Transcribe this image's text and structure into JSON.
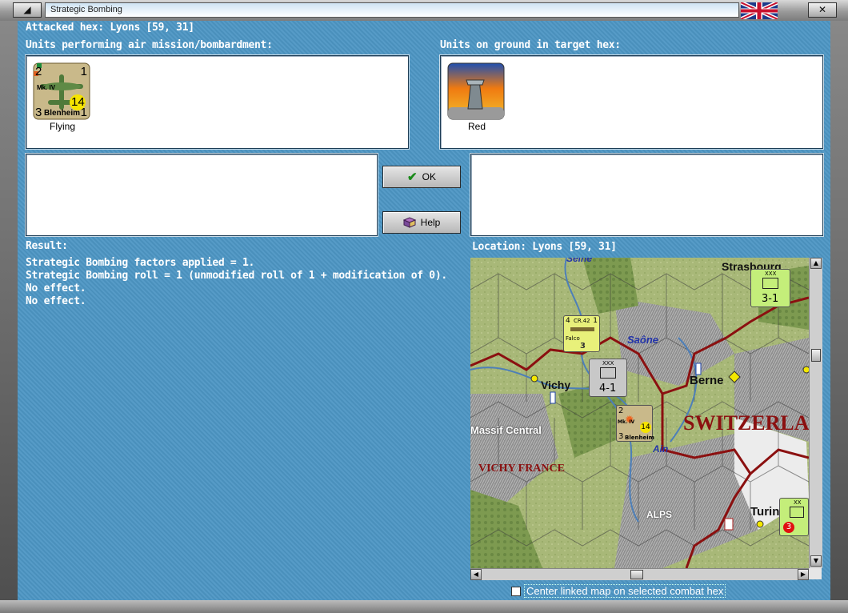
{
  "window": {
    "title": "Strategic Bombing",
    "close_glyph": "✕",
    "restore_glyph": "◢",
    "min_glyph": "⇤"
  },
  "header": {
    "attacked_hex": "Attacked hex: Lyons  [59, 31]"
  },
  "air_units": {
    "label": "Units performing air mission/bombardment:",
    "items": [
      {
        "counter_top_left": "2",
        "counter_top_right": "1",
        "counter_model": "Mk. IV",
        "counter_strength": "14",
        "counter_bottom_left": "3",
        "counter_bottom_right": "1",
        "counter_name": "Blenheim",
        "caption": "Flying"
      }
    ]
  },
  "ground_units": {
    "label": "Units on ground in target hex:",
    "items": [
      {
        "caption": "Red"
      }
    ]
  },
  "buttons": {
    "ok_label": "OK",
    "help_label": "Help"
  },
  "result": {
    "label": "Result:",
    "lines": [
      "Strategic Bombing factors applied = 1.",
      "Strategic Bombing roll = 1 (unmodified roll of 1 + modification of 0).",
      "No effect.",
      "No effect."
    ]
  },
  "location": {
    "label": "Location:  Lyons  [59, 31]"
  },
  "map": {
    "labels": {
      "seine": "Seine",
      "strasbourg": "Strasbourg",
      "saone": "Saône",
      "vichy": "Vichy",
      "berne": "Berne",
      "massif": "Massif Central",
      "switzerland": "SWITZERLAND",
      "vichy_france": "VICHY FRANCE",
      "ain": "Ain",
      "alps": "ALPS",
      "turin": "Turin"
    },
    "counters": {
      "fighter": {
        "model": "CR.42",
        "name": "Falco",
        "top": "4",
        "right": "1",
        "value": "3"
      },
      "corps": {
        "size": "XXX",
        "values": "4-1"
      },
      "bomber": {
        "top": "2",
        "model": "Mk. IV",
        "strength": "14",
        "bottom": "3",
        "name": "Blenheim"
      },
      "strasbourg_unit": {
        "size": "XXX",
        "values": "3-1"
      },
      "turin_unit": {
        "size": "XX",
        "value": "3"
      }
    }
  },
  "options": {
    "center_map_label": "Center linked map on selected combat hex",
    "center_map_checked": false
  },
  "colors": {
    "background": "#4d96c4",
    "border_red": "#8b1010",
    "map_green": "#a9b67a"
  }
}
